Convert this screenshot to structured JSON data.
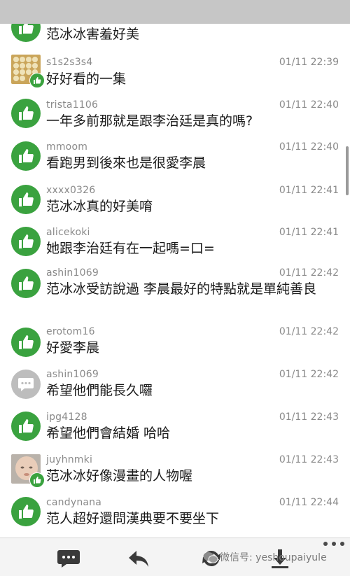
{
  "comments": [
    {
      "avatar": "like-icon",
      "user": "",
      "time": "",
      "text": "范冰冰害羞好美"
    },
    {
      "avatar": "photo",
      "user": "s1s2s3s4",
      "time": "01/11 22:39",
      "text": "好好看的一集"
    },
    {
      "avatar": "like-icon",
      "user": "trista1106",
      "time": "01/11 22:40",
      "text": "一年多前那就是跟李治廷是真的嗎?"
    },
    {
      "avatar": "like-icon",
      "user": "mmoom",
      "time": "01/11 22:40",
      "text": "看跑男到後來也是很愛李晨"
    },
    {
      "avatar": "like-icon",
      "user": "xxxx0326",
      "time": "01/11 22:41",
      "text": "范冰冰真的好美唷"
    },
    {
      "avatar": "like-icon",
      "user": "alicekoki",
      "time": "01/11 22:41",
      "text": "她跟李治廷有在一起嗎=口="
    },
    {
      "avatar": "like-icon",
      "user": "ashin1069",
      "time": "01/11 22:42",
      "text": "范冰冰受訪說過 李晨最好的特點就是單純善良"
    },
    {
      "avatar": "like-icon",
      "user": "erotom16",
      "time": "01/11 22:42",
      "text": "好愛李晨"
    },
    {
      "avatar": "chat-icon",
      "user": "ashin1069",
      "time": "01/11 22:42",
      "text": "希望他們能長久囉"
    },
    {
      "avatar": "like-icon",
      "user": "ipg4128",
      "time": "01/11 22:43",
      "text": "希望他們會結婚 哈哈"
    },
    {
      "avatar": "photo-baby",
      "user": "juyhnmki",
      "time": "01/11 22:43",
      "text": "范冰冰好像漫畫的人物喔"
    },
    {
      "avatar": "like-icon",
      "user": "candynana",
      "time": "01/11 22:44",
      "text": "范人超好還問漢典要不要坐下"
    }
  ],
  "bottom_bar": {
    "icons": [
      "comment-icon",
      "back-icon",
      "refresh-icon",
      "download-icon",
      "more-icon"
    ],
    "watermark": "微信号: yeshoupaiyule"
  },
  "colors": {
    "like_green": "#3aa23f",
    "chat_grey": "#bdbdbd",
    "meta_grey": "#8a8a8a"
  }
}
